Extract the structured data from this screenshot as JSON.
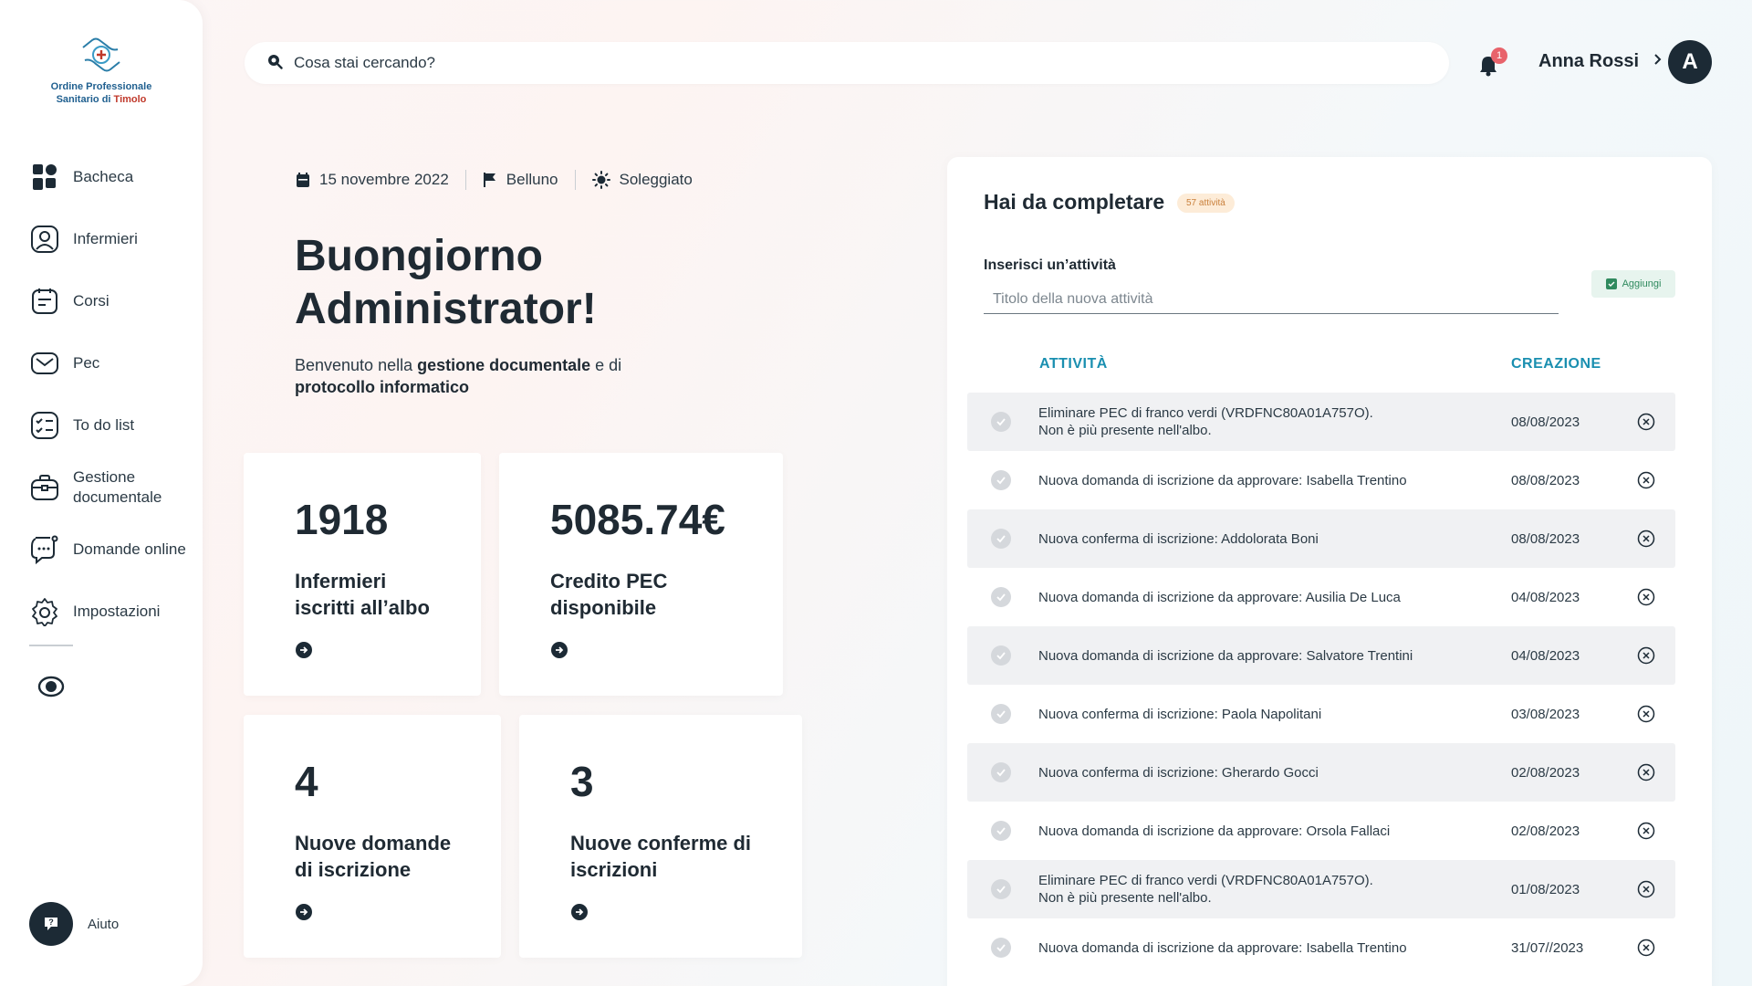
{
  "brand": {
    "line1": "Ordine Professionale",
    "line2_prefix": "Sanitario di ",
    "line2_city": "Timolo",
    "icon": "medical-hands-icon"
  },
  "sidebar": {
    "items": [
      {
        "label": "Bacheca",
        "icon": "dashboard-icon"
      },
      {
        "label": "Infermieri",
        "icon": "user-icon"
      },
      {
        "label": "Corsi",
        "icon": "course-icon"
      },
      {
        "label": "Pec",
        "icon": "mail-icon"
      },
      {
        "label": "To do list",
        "icon": "checklist-icon"
      },
      {
        "label": "Gestione documentale",
        "icon": "briefcase-icon"
      },
      {
        "label": "Domande online",
        "icon": "chat-icon"
      },
      {
        "label": "Impostazioni",
        "icon": "gear-icon"
      }
    ],
    "help_label": "Aiuto"
  },
  "header": {
    "search_placeholder": "Cosa stai cercando?",
    "notifications_count": "1",
    "user_name": "Anna Rossi",
    "avatar_initial": "A"
  },
  "info": {
    "date": "15 novembre 2022",
    "city": "Belluno",
    "weather": "Soleggiato"
  },
  "greeting": {
    "line1": "Buongiorno",
    "line2": "Administrator!",
    "welcome_pre": "Benvenuto nella ",
    "welcome_b1": "gestione documentale",
    "welcome_mid": " e di ",
    "welcome_b2": "protocollo informatico"
  },
  "cards": [
    {
      "value": "1918",
      "label": "Infermieri iscritti all’albo"
    },
    {
      "value": "5085.74€",
      "label": "Credito PEC disponibile"
    },
    {
      "value": "4",
      "label": "Nuove domande di iscrizione"
    },
    {
      "value": "3",
      "label": "Nuove conferme di iscrizioni"
    }
  ],
  "tasks": {
    "title": "Hai da completare",
    "badge": "57 attività",
    "input_label": "Inserisci un’attività",
    "input_placeholder": "Titolo della nuova attività",
    "add_label": "Aggiungi",
    "col_activity": "ATTIVITÀ",
    "col_created": "CREAZIONE",
    "rows": [
      {
        "text": "Eliminare PEC di franco verdi (VRDFNC80A01A757O).\nNon è più presente nell'albo.",
        "date": "08/08/2023"
      },
      {
        "text": "Nuova domanda di iscrizione da approvare: Isabella Trentino",
        "date": "08/08/2023"
      },
      {
        "text": "Nuova conferma di iscrizione: Addolorata Boni",
        "date": "08/08/2023"
      },
      {
        "text": "Nuova domanda di iscrizione da approvare: Ausilia De Luca",
        "date": "04/08/2023"
      },
      {
        "text": "Nuova domanda di iscrizione da approvare: Salvatore Trentini",
        "date": "04/08/2023"
      },
      {
        "text": "Nuova conferma di iscrizione: Paola Napolitani",
        "date": "03/08/2023"
      },
      {
        "text": "Nuova conferma di iscrizione: Gherardo Gocci",
        "date": "02/08/2023"
      },
      {
        "text": "Nuova domanda di iscrizione da approvare: Orsola Fallaci",
        "date": "02/08/2023"
      },
      {
        "text": "Eliminare PEC di franco verdi (VRDFNC80A01A757O).\nNon è più presente nell'albo.",
        "date": "01/08/2023"
      },
      {
        "text": "Nuova domanda di iscrizione da approvare: Isabella Trentino",
        "date": "31/07//2023"
      }
    ]
  },
  "colors": {
    "accent_teal": "#1a8fb0",
    "dark": "#1c2a35",
    "badge_red": "#e8636b",
    "success_green": "#2f8a5e"
  }
}
